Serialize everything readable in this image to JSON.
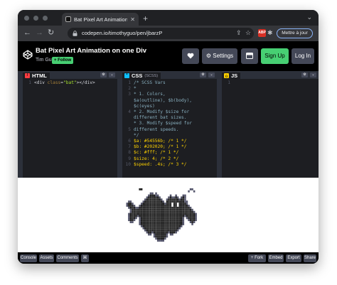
{
  "browser": {
    "tab_title": "Bat Pixel Art Animation on one Div",
    "url": "codepen.io/timothyguo/pen/jbarzP",
    "profile_button": "Mettre à jour",
    "ext_badge": "ABP"
  },
  "header": {
    "title": "Bat Pixel Art Animation on one Div",
    "author": "Tim Guo",
    "follow": "+ Follow",
    "settings": "Settings",
    "signup": "Sign Up",
    "login": "Log In"
  },
  "panes": [
    {
      "name": "HTML",
      "sub": "",
      "icon_letter": "/",
      "color": "#ff3c41",
      "line_numbers": [
        "1"
      ]
    },
    {
      "name": "CSS",
      "sub": "(SCSS)",
      "icon_letter": "*",
      "color": "#0ebeff",
      "line_numbers": [
        "1",
        "2",
        "3",
        "",
        "",
        "4",
        "",
        "",
        "5",
        "",
        "6",
        "7",
        "8",
        "9",
        "10",
        "11"
      ]
    },
    {
      "name": "JS",
      "sub": "",
      "icon_letter": "{}",
      "color": "#fcd000",
      "line_numbers": [
        "1"
      ]
    }
  ],
  "html_code": {
    "open": "<div ",
    "attr": "class",
    "eq": "=",
    "val": "\"bat\"",
    "close": "></div>"
  },
  "css_code": [
    "/* SCSS Vars",
    " *",
    " * 1. Colors,",
    "$a(outline), $b(body),",
    "$c(eyes)",
    " * 2. Modify $size for",
    "different bat sizes.",
    " * 3. Modify $speed for",
    "different speeds.",
    " */",
    "$a: #54556b;   /* 1 */",
    "$b: #202020;   /* 1 */",
    "$c: #fff;      /* 1 */",
    "$size: 4;      /* 2 */",
    "$speed: .4s;   /* 3 */"
  ],
  "footer": {
    "console": "Console",
    "assets": "Assets",
    "comments": "Comments",
    "shortcut": "⌘",
    "fork": "Fork",
    "embed": "Embed",
    "export": "Export",
    "share": "Share"
  },
  "icons": {
    "heart": "heart-icon",
    "gear": "gear-icon",
    "layout": "layout-icon"
  },
  "colors": {
    "accent_green": "#47cf73",
    "editor_bg": "#1d1e22",
    "header_bg": "#000000",
    "button_bg": "#444857"
  }
}
